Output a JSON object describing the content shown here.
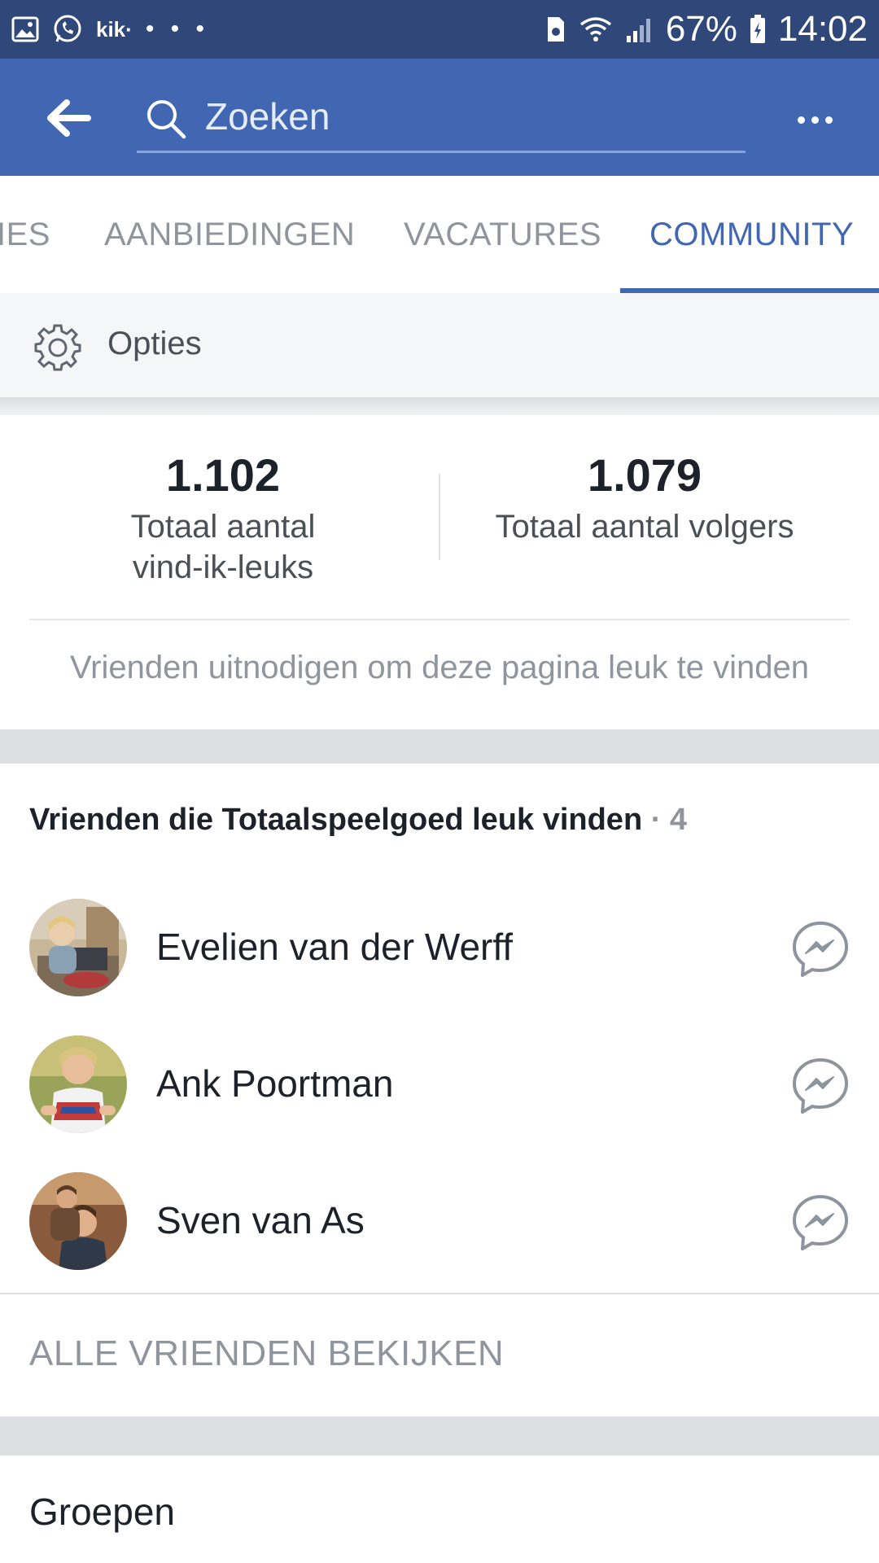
{
  "status_bar": {
    "kik_label": "kik·",
    "dots": "• • •",
    "battery": "67%",
    "time": "14:02",
    "icons": [
      "gallery-icon",
      "whatsapp-icon",
      "kik-icon",
      "sim-icon",
      "wifi-icon",
      "signal-icon",
      "battery-icon"
    ]
  },
  "header": {
    "search_placeholder": "Zoeken",
    "colors": {
      "bar": "#4267b2",
      "status": "#2f4779"
    }
  },
  "tabs": [
    {
      "label": "IES",
      "active": false
    },
    {
      "label": "AANBIEDINGEN",
      "active": false
    },
    {
      "label": "VACATURES",
      "active": false
    },
    {
      "label": "COMMUNITY",
      "active": true
    }
  ],
  "options": {
    "label": "Opties"
  },
  "stats": {
    "likes": {
      "value": "1.102",
      "label_line1": "Totaal aantal",
      "label_line2": "vind-ik-leuks"
    },
    "followers": {
      "value": "1.079",
      "label": "Totaal aantal volgers"
    },
    "invite": "Vrienden uitnodigen om deze pagina leuk te vinden"
  },
  "friends": {
    "title": "Vrienden die Totaalspeelgoed leuk vinden",
    "count": "· 4",
    "items": [
      {
        "name": "Evelien van der Werff"
      },
      {
        "name": "Ank Poortman"
      },
      {
        "name": "Sven van As"
      }
    ],
    "see_all": "ALLE VRIENDEN BEKIJKEN"
  },
  "groups": {
    "title": "Groepen"
  }
}
